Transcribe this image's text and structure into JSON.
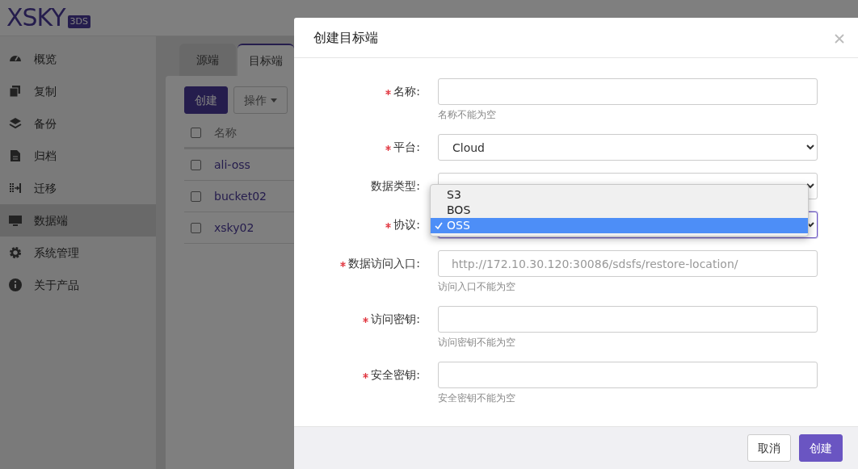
{
  "app": {
    "logo": "XSKY",
    "logo_badge": "3DS"
  },
  "sidebar": {
    "items": [
      {
        "label": "概览",
        "selected": false
      },
      {
        "label": "复制",
        "selected": false
      },
      {
        "label": "备份",
        "selected": false
      },
      {
        "label": "归档",
        "selected": false
      },
      {
        "label": "迁移",
        "selected": false
      },
      {
        "label": "数据端",
        "selected": true
      },
      {
        "label": "系统管理",
        "selected": false
      },
      {
        "label": "关于产品",
        "selected": false
      }
    ]
  },
  "tabs": [
    {
      "label": "源端",
      "selected": false
    },
    {
      "label": "目标端",
      "selected": true
    }
  ],
  "toolbar": {
    "buttons": [
      {
        "label": "创建",
        "kind": "primary"
      },
      {
        "label": "操作",
        "kind": "dropdown"
      }
    ]
  },
  "table": {
    "select_all": {
      "checked": false
    },
    "columns": [
      "名称"
    ],
    "rows": [
      {
        "name": "ali-oss",
        "checked": false
      },
      {
        "name": "bucket02",
        "checked": false
      },
      {
        "name": "xsky02",
        "checked": false
      }
    ]
  },
  "modal": {
    "title": "创建目标端",
    "fields": [
      {
        "label": "名称:",
        "required": true,
        "kind": "text",
        "help": "名称不能为空"
      },
      {
        "label": "平台:",
        "required": true,
        "kind": "select",
        "value": "Cloud"
      },
      {
        "label": "数据类型:",
        "required": false,
        "kind": "select"
      },
      {
        "label": "协议:",
        "required": true,
        "kind": "select",
        "focused": true,
        "options": [
          {
            "label": "S3",
            "selected": false
          },
          {
            "label": "BOS",
            "selected": false
          },
          {
            "label": "OSS",
            "selected": true
          }
        ]
      },
      {
        "label": "数据访问入口:",
        "required": true,
        "kind": "text",
        "placeholder": "http://172.10.30.120:30086/sdsfs/restore-location/",
        "help": "访问入口不能为空"
      },
      {
        "label": "访问密钥:",
        "required": true,
        "kind": "text",
        "help": "访问密钥不能为空"
      },
      {
        "label": "安全密钥:",
        "required": true,
        "kind": "text",
        "help": "安全密钥不能为空"
      }
    ],
    "buttons": [
      {
        "label": "取消",
        "kind": "secondary"
      },
      {
        "label": "创建",
        "kind": "primary"
      }
    ]
  }
}
